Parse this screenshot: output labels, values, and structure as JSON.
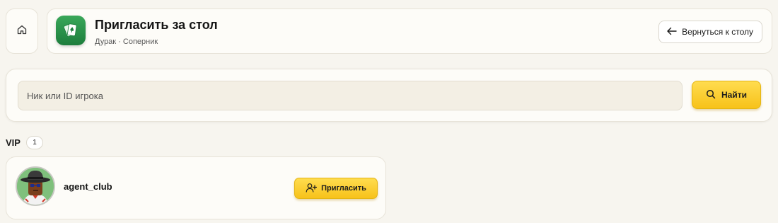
{
  "header": {
    "home_icon": "home-icon",
    "app_icon": "cards-icon",
    "title": "Пригласить за стол",
    "subtitle": "Дурак · Соперник",
    "back_icon": "arrow-left-icon",
    "back_label": "Вернуться к столу"
  },
  "search": {
    "placeholder": "Ник или ID игрока",
    "value": "",
    "button_icon": "search-icon",
    "button_label": "Найти"
  },
  "vip_section": {
    "label": "VIP",
    "count": "1",
    "players": [
      {
        "name": "agent_club",
        "avatar": "avatar",
        "invite_icon": "user-plus-icon",
        "invite_label": "Пригласить"
      }
    ]
  },
  "colors": {
    "accent_yellow": "#f7c21a",
    "app_green": "#2a8f48",
    "background": "#f7f5ef"
  }
}
